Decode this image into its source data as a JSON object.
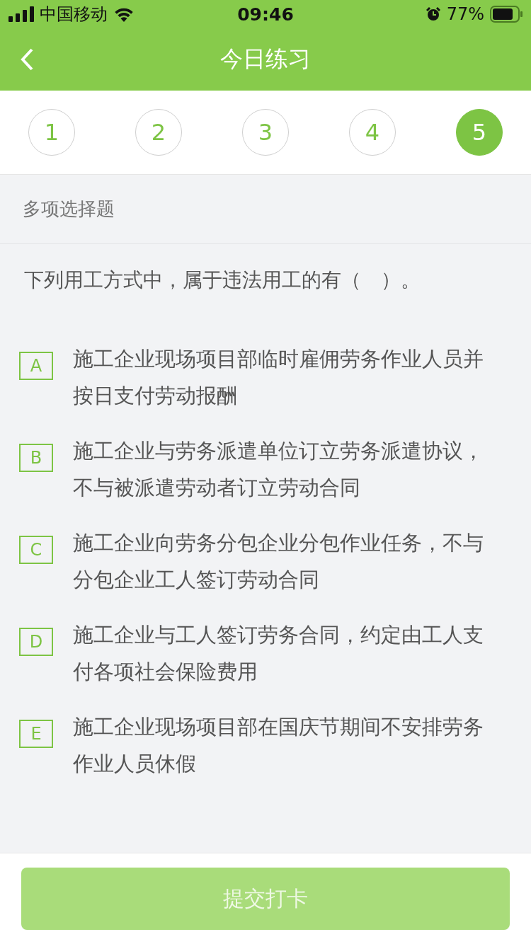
{
  "status_bar": {
    "carrier": "中国移动",
    "time": "09:46",
    "battery": "77%"
  },
  "nav": {
    "title": "今日练习"
  },
  "steps": [
    {
      "label": "1",
      "selected": false
    },
    {
      "label": "2",
      "selected": false
    },
    {
      "label": "3",
      "selected": false
    },
    {
      "label": "4",
      "selected": false
    },
    {
      "label": "5",
      "selected": true
    }
  ],
  "question": {
    "type": "多项选择题",
    "text": "下列用工方式中，属于违法用工的有（　）。",
    "options": [
      {
        "letter": "A",
        "text": "施工企业现场项目部临时雇佣劳务作业人员并按日支付劳动报酬",
        "selected": false
      },
      {
        "letter": "B",
        "text": "施工企业与劳务派遣单位订立劳务派遣协议，不与被派遣劳动者订立劳动合同",
        "selected": false
      },
      {
        "letter": "C",
        "text": "施工企业向劳务分包企业分包作业任务，不与分包企业工人签订劳动合同",
        "selected": false
      },
      {
        "letter": "D",
        "text": "施工企业与工人签订劳务合同，约定由工人支付各项社会保险费用",
        "selected": false
      },
      {
        "letter": "E",
        "text": "施工企业现场项目部在国庆节期间不安排劳务作业人员休假",
        "selected": false
      }
    ]
  },
  "submit": {
    "label": "提交打卡",
    "disabled": true
  }
}
